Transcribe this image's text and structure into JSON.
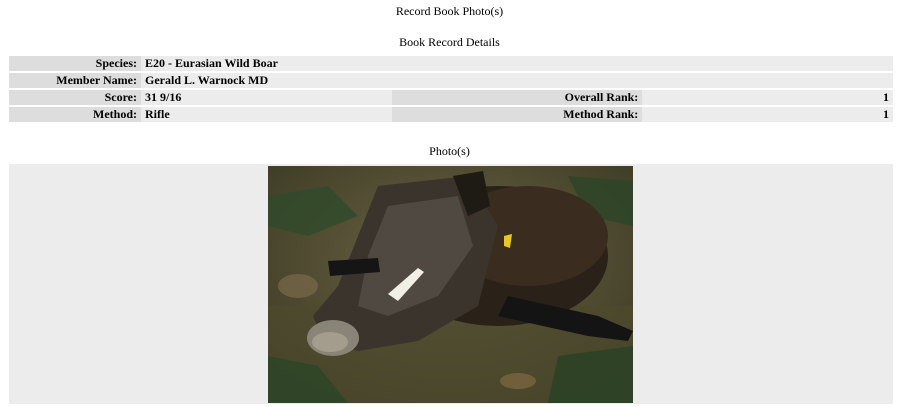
{
  "page": {
    "title": "Record Book Photo(s)"
  },
  "details": {
    "section_title": "Book Record Details",
    "species_label": "Species:",
    "species_value": "E20 - Eurasian Wild Boar",
    "member_label": "Member Name:",
    "member_value": "Gerald L. Warnock MD",
    "score_label": "Score:",
    "score_value": "31 9/16",
    "method_label": "Method:",
    "method_value": "Rifle",
    "overall_rank_label": "Overall Rank:",
    "overall_rank_value": "1",
    "method_rank_label": "Method Rank:",
    "method_rank_value": "1"
  },
  "photos": {
    "section_title": "Photo(s)"
  }
}
